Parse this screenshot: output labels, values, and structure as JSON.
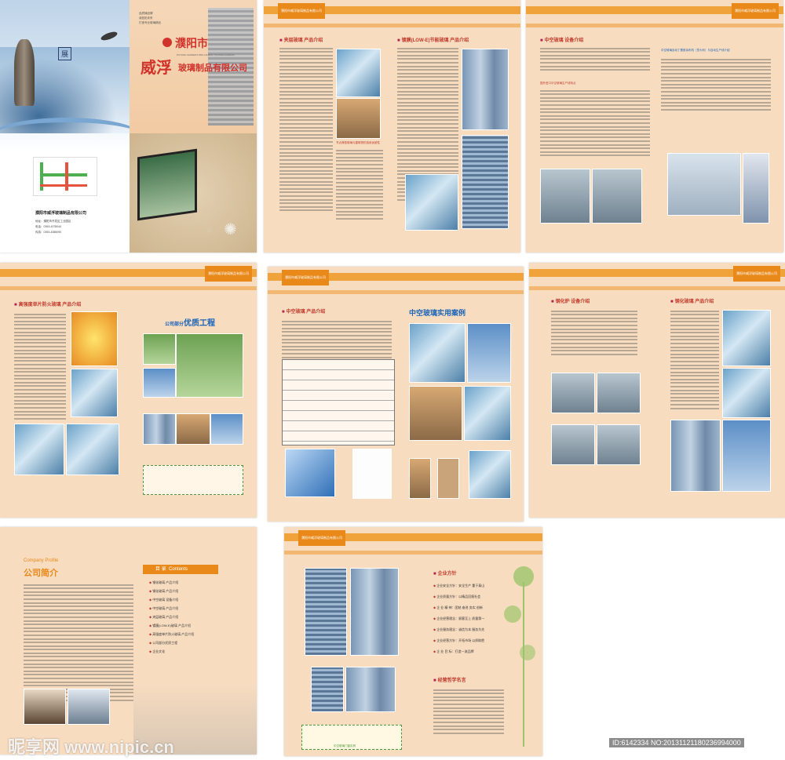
{
  "cover": {
    "city": "濮阳市",
    "brand": "威浮",
    "company_short": "玻璃制品有限公司",
    "pinyin": "PUYANG SHIWEIFU BOLI ZHIPIN YOUXIAN GONGSI",
    "slogan_1": "品质铸品牌",
    "slogan_2": "诚信拓未来",
    "slogan_3": "打造专业玻璃精品",
    "exhibit_seal": "展",
    "back_company": "濮阳市威浮玻璃制品有限公司",
    "address": "濮阳市开发区工业园区",
    "tel": "0393-4378044",
    "fax": "0393-4385090"
  },
  "header": {
    "company_tag": "濮阳市威浮玻璃制品有限公司"
  },
  "page2": {
    "title_left": "夹层玻璃 产品介绍",
    "title_right": "镀膜(LOW-E)节能玻璃 产品介绍",
    "mid_caption": "节点典型玻璃与建筑物的选用优越性"
  },
  "page3": {
    "title": "中空玻璃 设备介绍",
    "sub_title_1": "国外进口中空玻璃生产线特点",
    "sub_title_2": "中空玻璃自动丁基胶涂布机（意大利）与自动生产线介绍"
  },
  "page4": {
    "title": "高强度单片防火玻璃 产品介绍",
    "projects_title_small": "公司部分",
    "projects_title_big": "优质工程"
  },
  "page5": {
    "title": "中空玻璃 产品介绍",
    "cases_title": "中空玻璃实用案例"
  },
  "page6": {
    "title_left": "钢化炉 设备介绍",
    "title_right": "钢化玻璃 产品介绍"
  },
  "page7": {
    "en_title": "Company Profile",
    "cn_title": "公司简介",
    "toc_cn": "目 录",
    "toc_en": "Contents",
    "toc": [
      "钢化玻璃 产品介绍",
      "钢化玻璃 产品介绍",
      "中空玻璃 设备介绍",
      "中空玻璃 产品介绍",
      "夹层玻璃 产品介绍",
      "镀膜(LOW-E)玻璃 产品介绍",
      "高强度单片防火玻璃 产品介绍",
      "公司部分优质工程",
      "企业文化"
    ]
  },
  "page8": {
    "policy_title": "企业方针",
    "policies": [
      "企业安全方针：安全生产 重于泰山",
      "企业质量方针：以精品回报社会",
      "企 业 精 神：团结 奋进 务实 创新",
      "企业经营理念：顾客至上 质量第一",
      "企业服务理念：诚信为本 服务为先",
      "企业经营方针：开拓市场 以质取胜",
      "企 业 目 标：打造一流品牌"
    ],
    "philosophy_title": "经营哲学名言",
    "bottom_caption": "中空玻璃门窗实例"
  },
  "watermark": {
    "site": "昵享网 www.nipic.cn",
    "id": "ID:6142334 NO:20131121180236994000"
  },
  "colors": {
    "page_bg": "#f7dcc0",
    "orange": "#e8891a",
    "title_red": "#c0392b",
    "heading_blue": "#1a64b8"
  }
}
